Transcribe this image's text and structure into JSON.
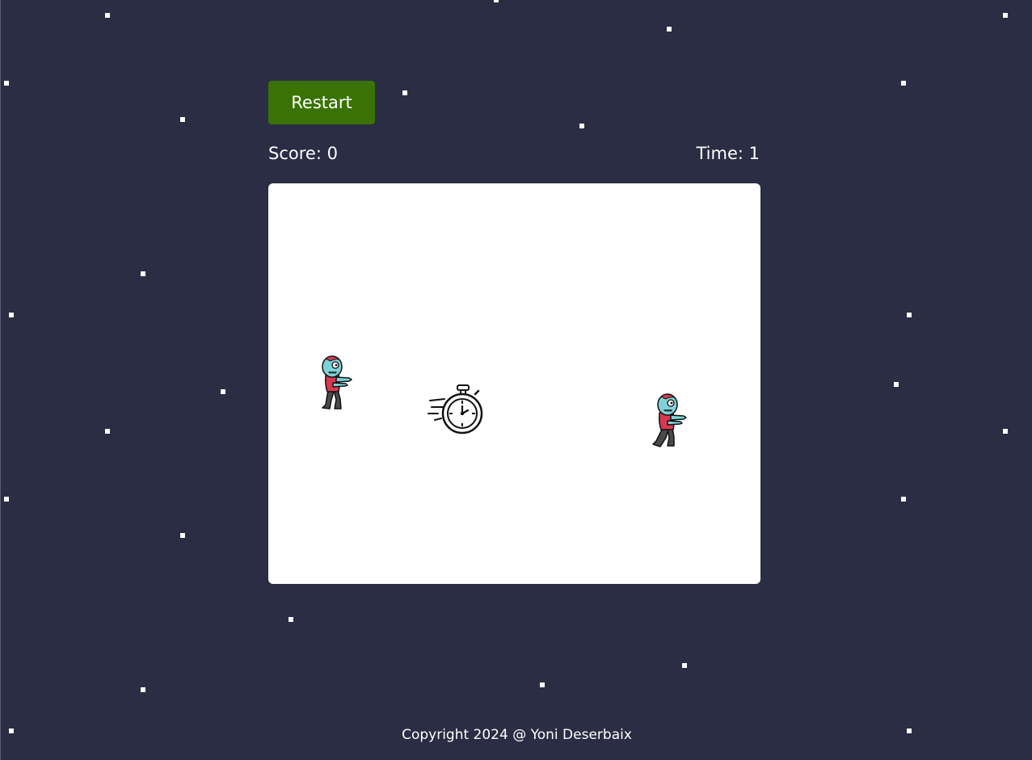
{
  "toolbar": {
    "restart_label": "Restart"
  },
  "hud": {
    "score": "Score: 0",
    "time": "Time: 1"
  },
  "board": {
    "sprites": [
      {
        "name": "zombie",
        "icon": "zombie-icon"
      },
      {
        "name": "stopwatch",
        "icon": "stopwatch-icon"
      },
      {
        "name": "zombie",
        "icon": "zombie-icon"
      }
    ]
  },
  "footer": {
    "copyright": "Copyright 2024 @ Yoni Deserbaix"
  },
  "colors": {
    "background": "#2a2d43",
    "restart_button": "#3a7303",
    "board": "#ffffff",
    "zombie_skin": "#7fd3d8",
    "zombie_shirt": "#d9394f",
    "zombie_pants": "#4a4a4a"
  }
}
